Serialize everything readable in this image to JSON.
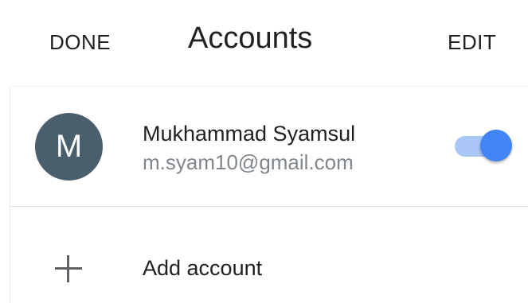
{
  "header": {
    "done_label": "DONE",
    "title": "Accounts",
    "edit_label": "EDIT"
  },
  "account": {
    "avatar_initial": "M",
    "name": "Mukhammad Syamsul",
    "email": "m.syam10@gmail.com",
    "sync_enabled": true
  },
  "add_account": {
    "icon": "plus-icon",
    "label": "Add account"
  },
  "colors": {
    "avatar_bg": "#4a5f6d",
    "toggle_knob": "#4285f4",
    "toggle_track": "#a9c6f7",
    "secondary_text": "#80868b"
  }
}
